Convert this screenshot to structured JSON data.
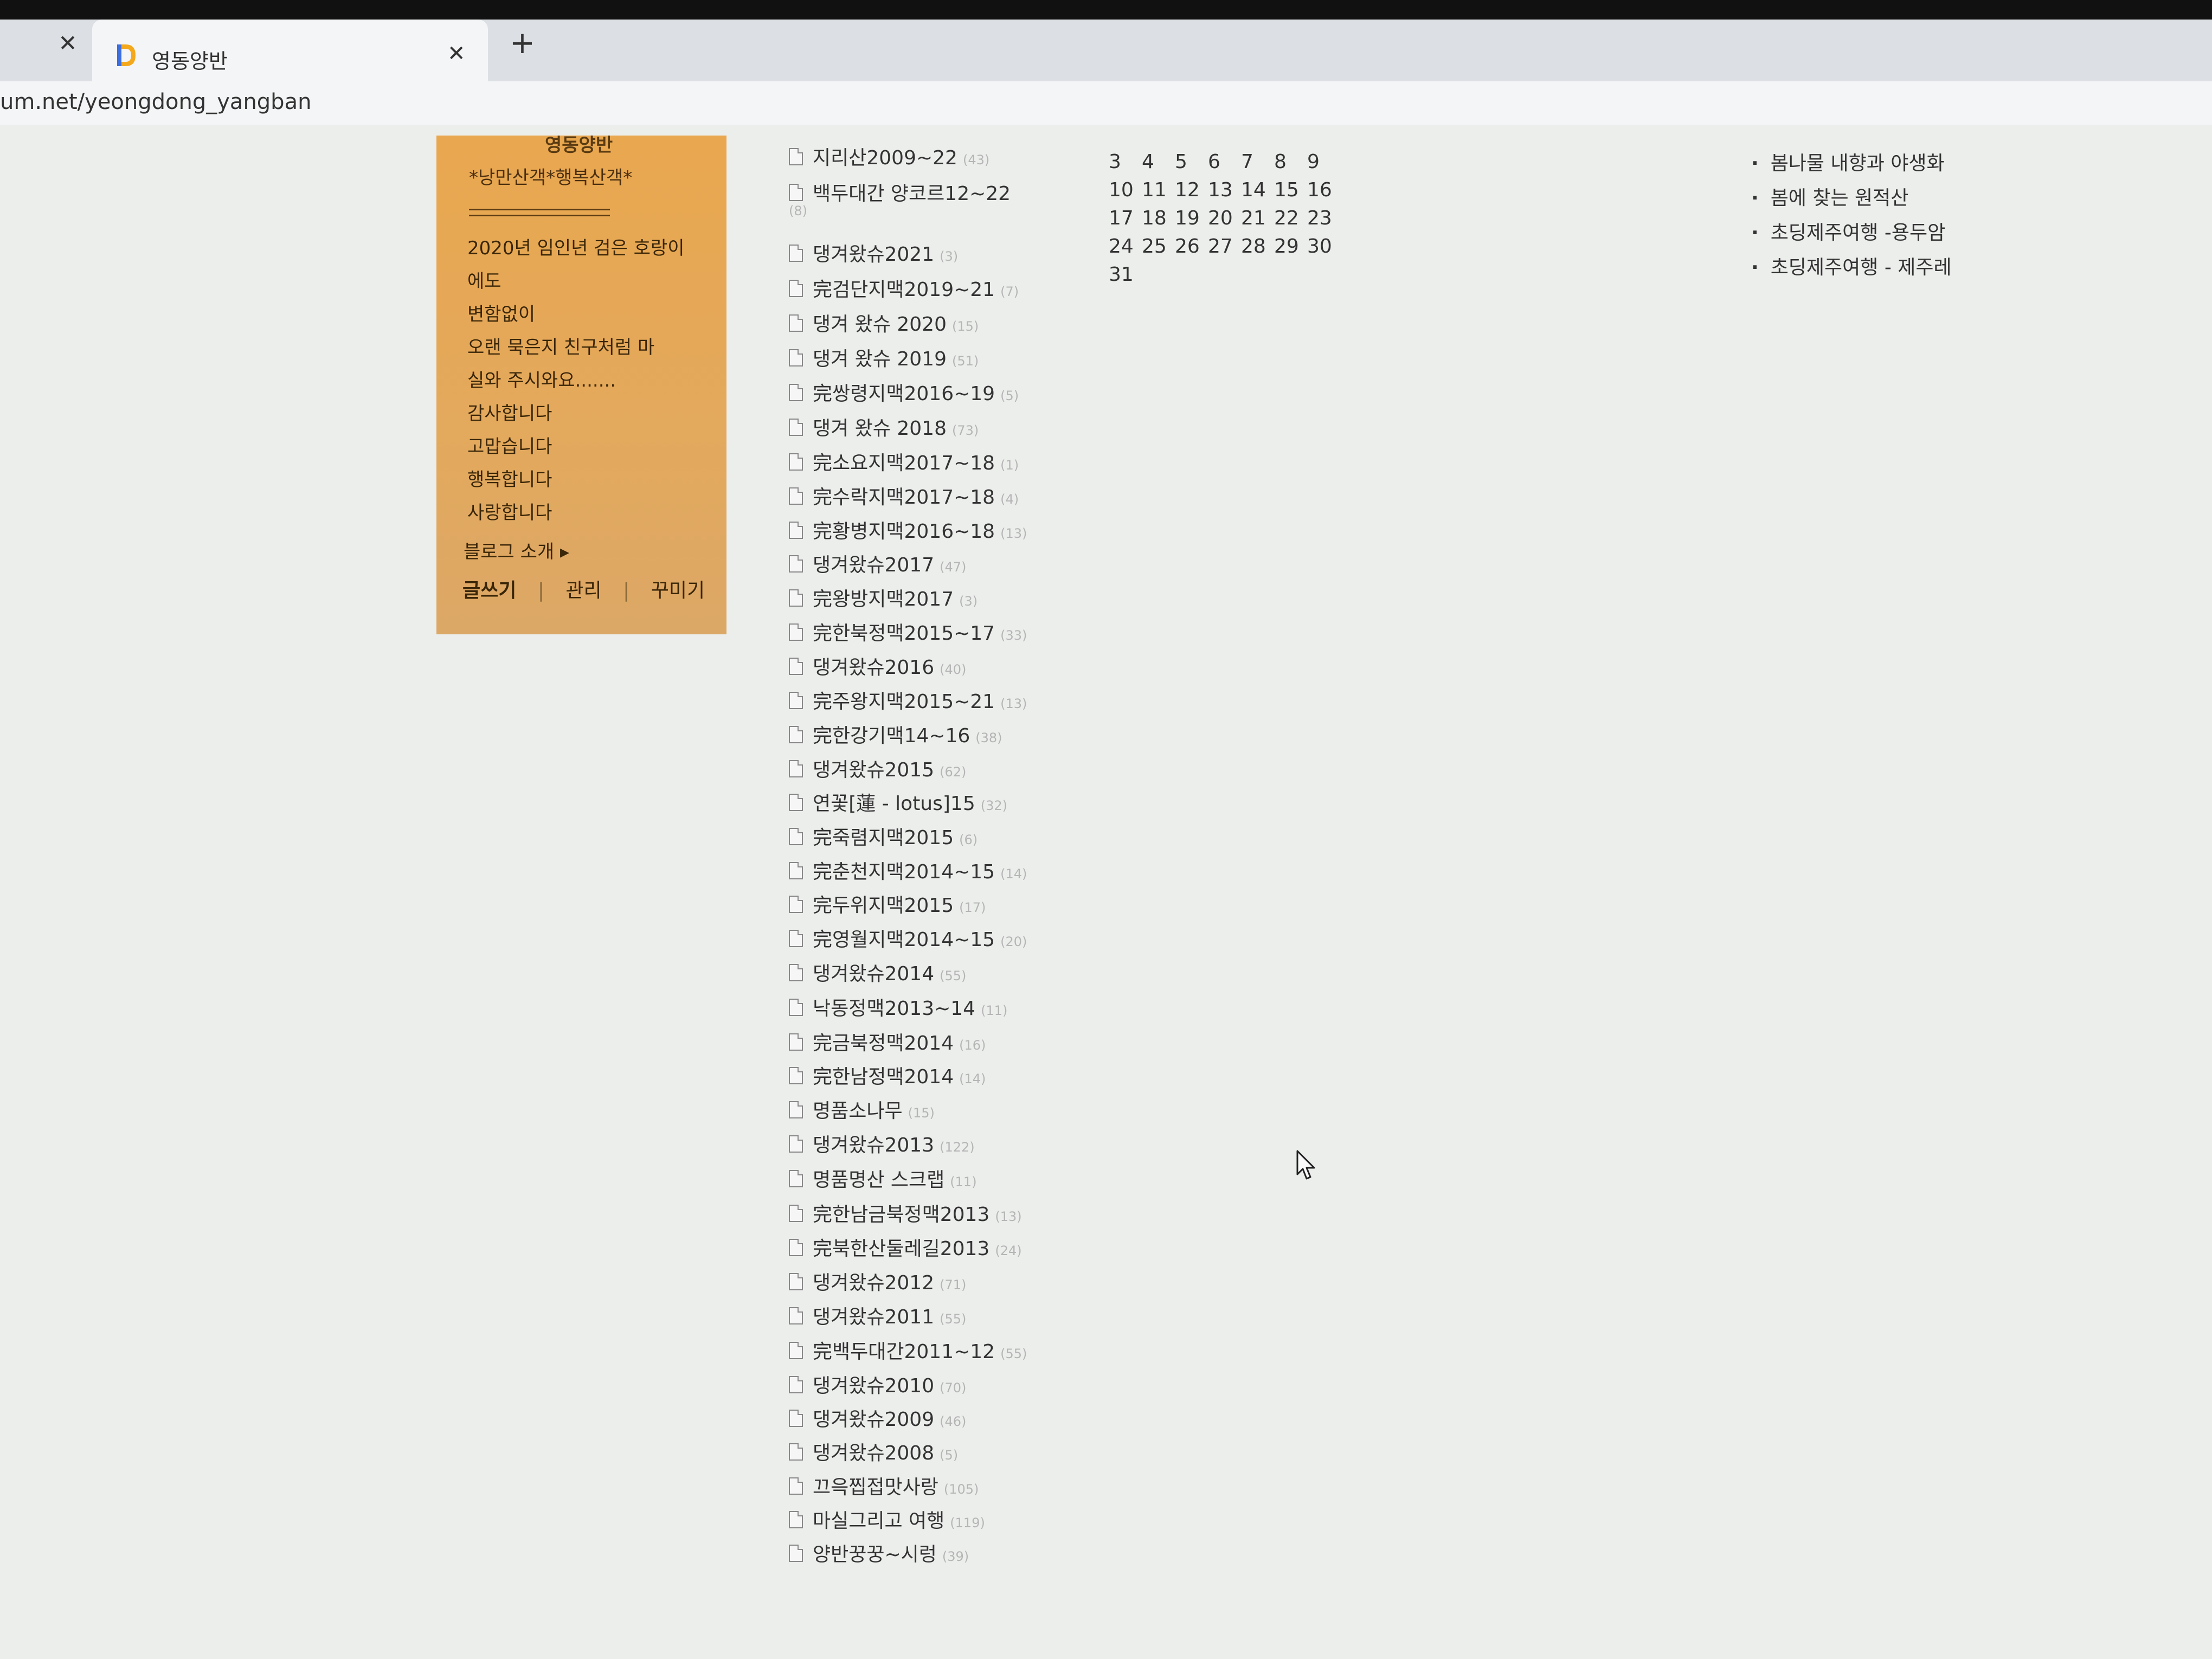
{
  "browser": {
    "tab_title": "영동양반",
    "close_glyph": "✕",
    "new_tab_glyph": "+",
    "url": "um.net/yeongdong_yangban"
  },
  "profile": {
    "header_fragment": "영동양반",
    "subtitle": "*낭만산객*행복산객*",
    "messages": [
      "2020년 임인년 검은 호랑이",
      "에도",
      "변함없이",
      "오랜 묵은지 친구처럼 마",
      "실와 주시와요.......",
      "감사합니다",
      "고맙습니다",
      "행복합니다",
      "사랑합니다"
    ],
    "intro_link": "블로그 소개 ▸",
    "actions": {
      "write": "글쓰기",
      "manage": "관리",
      "decorate": "꾸미기",
      "separator": "|"
    }
  },
  "categories": [
    {
      "name": "지리산2009~22",
      "count": "(43)"
    },
    {
      "name": "백두대간 양코르12~22",
      "count": "(8)"
    },
    {
      "name": "댕겨왔슈2021",
      "count": "(3)"
    },
    {
      "name": "完검단지맥2019~21",
      "count": "(7)"
    },
    {
      "name": "댕겨 왔슈 2020",
      "count": "(15)"
    },
    {
      "name": "댕겨 왔슈 2019",
      "count": "(51)"
    },
    {
      "name": "完쌍령지맥2016~19",
      "count": "(5)"
    },
    {
      "name": "댕겨 왔슈 2018",
      "count": "(73)"
    },
    {
      "name": "完소요지맥2017~18",
      "count": "(1)"
    },
    {
      "name": "完수락지맥2017~18",
      "count": "(4)"
    },
    {
      "name": "完황병지맥2016~18",
      "count": "(13)"
    },
    {
      "name": "댕겨왔슈2017",
      "count": "(47)"
    },
    {
      "name": "完왕방지맥2017",
      "count": "(3)"
    },
    {
      "name": "完한북정맥2015~17",
      "count": "(33)"
    },
    {
      "name": "댕겨왔슈2016",
      "count": "(40)"
    },
    {
      "name": "完주왕지맥2015~21",
      "count": "(13)"
    },
    {
      "name": "完한강기맥14~16",
      "count": "(38)"
    },
    {
      "name": "댕겨왔슈2015",
      "count": "(62)"
    },
    {
      "name": "연꽃[蓮 - lotus]15",
      "count": "(32)"
    },
    {
      "name": "完죽렴지맥2015",
      "count": "(6)"
    },
    {
      "name": "完춘천지맥2014~15",
      "count": "(14)"
    },
    {
      "name": "完두위지맥2015",
      "count": "(17)"
    },
    {
      "name": "完영월지맥2014~15",
      "count": "(20)"
    },
    {
      "name": "댕겨왔슈2014",
      "count": "(55)"
    },
    {
      "name": "낙동정맥2013~14",
      "count": "(11)"
    },
    {
      "name": "完금북정맥2014",
      "count": "(16)"
    },
    {
      "name": "完한남정맥2014",
      "count": "(14)"
    },
    {
      "name": "명품소나무",
      "count": "(15)"
    },
    {
      "name": "댕겨왔슈2013",
      "count": "(122)"
    },
    {
      "name": "명품명산 스크랩",
      "count": "(11)"
    },
    {
      "name": "完한남금북정맥2013",
      "count": "(13)"
    },
    {
      "name": "完북한산둘레길2013",
      "count": "(24)"
    },
    {
      "name": "댕겨왔슈2012",
      "count": "(71)"
    },
    {
      "name": "댕겨왔슈2011",
      "count": "(55)"
    },
    {
      "name": "完백두대간2011~12",
      "count": "(55)"
    },
    {
      "name": "댕겨왔슈2010",
      "count": "(70)"
    },
    {
      "name": "댕겨왔슈2009",
      "count": "(46)"
    },
    {
      "name": "댕겨왔슈2008",
      "count": "(5)"
    },
    {
      "name": "끄윽찝접맛사랑",
      "count": "(105)"
    },
    {
      "name": "마실그리고 여행",
      "count": "(119)"
    },
    {
      "name": "양반꿍꿍~시렁",
      "count": "(39)"
    }
  ],
  "calendar": {
    "rows": [
      [
        "3",
        "4",
        "5",
        "6",
        "7",
        "8",
        "9"
      ],
      [
        "10",
        "11",
        "12",
        "13",
        "14",
        "15",
        "16"
      ],
      [
        "17",
        "18",
        "19",
        "20",
        "21",
        "22",
        "23"
      ],
      [
        "24",
        "25",
        "26",
        "27",
        "28",
        "29",
        "30"
      ],
      [
        "31"
      ]
    ]
  },
  "recent_posts": [
    "봄나물 내향과 야생화",
    "봄에 찾는 원적산",
    "초딩제주여행 -용두암",
    "초딩제주여행 - 제주레"
  ]
}
